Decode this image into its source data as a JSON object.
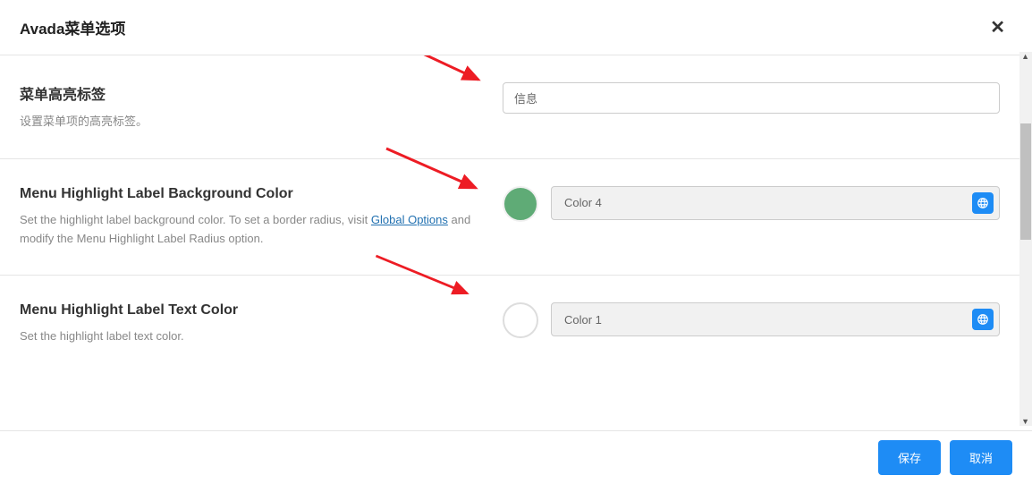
{
  "header": {
    "title": "Avada菜单选项"
  },
  "settings": [
    {
      "title": "菜单高亮标签",
      "desc": "设置菜单项的高亮标签。",
      "input_value": "信息"
    },
    {
      "title": "Menu Highlight Label Background Color",
      "desc_pre": "Set the highlight label background color. To set a border radius, visit ",
      "desc_link": "Global Options",
      "desc_post": " and modify the Menu Highlight Label Radius option.",
      "color_label": "Color 4",
      "swatch_color": "#5fab76"
    },
    {
      "title": "Menu Highlight Label Text Color",
      "desc": "Set the highlight label text color.",
      "color_label": "Color 1",
      "swatch_color": "#ffffff"
    }
  ],
  "footer": {
    "save": "保存",
    "cancel": "取消"
  }
}
